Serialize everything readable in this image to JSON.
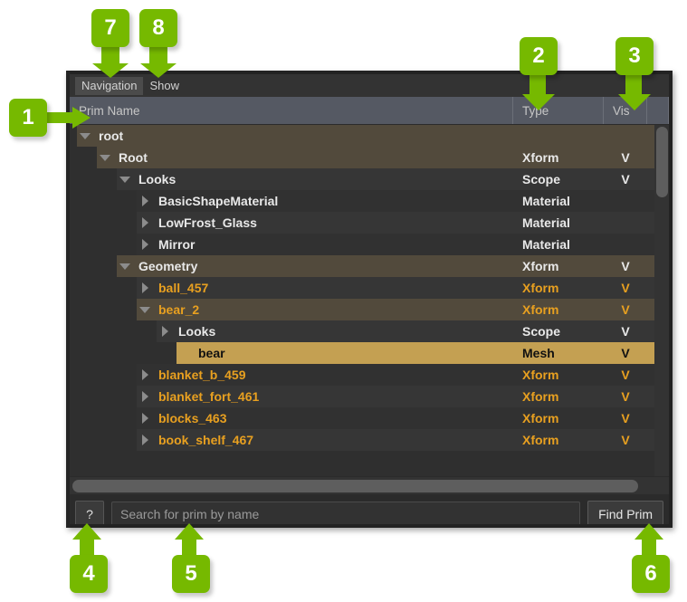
{
  "colors": {
    "badge_green": "#76b900",
    "selected_row": "#c4a052",
    "orange_text": "#e8a020",
    "panel_bg": "#2b2b2b"
  },
  "menubar": {
    "items": [
      {
        "label": "Navigation"
      },
      {
        "label": "Show"
      }
    ]
  },
  "columns": [
    {
      "label": "Prim Name"
    },
    {
      "label": "Type"
    },
    {
      "label": "Vis"
    }
  ],
  "tree": {
    "rows": [
      {
        "name": "root",
        "type": "",
        "vis": "",
        "depth": 0,
        "twisty": "down",
        "color": "white",
        "bg": "brown"
      },
      {
        "name": "Root",
        "type": "Xform",
        "vis": "V",
        "depth": 1,
        "twisty": "down",
        "color": "white",
        "bg": "brown"
      },
      {
        "name": "Looks",
        "type": "Scope",
        "vis": "V",
        "depth": 2,
        "twisty": "down",
        "color": "white",
        "bg": "dark"
      },
      {
        "name": "BasicShapeMaterial",
        "type": "Material",
        "vis": "",
        "depth": 3,
        "twisty": "right",
        "color": "white",
        "bg": "darker"
      },
      {
        "name": "LowFrost_Glass",
        "type": "Material",
        "vis": "",
        "depth": 3,
        "twisty": "right",
        "color": "white",
        "bg": "dark"
      },
      {
        "name": "Mirror",
        "type": "Material",
        "vis": "",
        "depth": 3,
        "twisty": "right",
        "color": "white",
        "bg": "darker"
      },
      {
        "name": "Geometry",
        "type": "Xform",
        "vis": "V",
        "depth": 2,
        "twisty": "down",
        "color": "white",
        "bg": "brown"
      },
      {
        "name": "ball_457",
        "type": "Xform",
        "vis": "V",
        "depth": 3,
        "twisty": "right",
        "color": "orange",
        "bg": "dark"
      },
      {
        "name": "bear_2",
        "type": "Xform",
        "vis": "V",
        "depth": 3,
        "twisty": "down",
        "color": "orange",
        "bg": "brown"
      },
      {
        "name": "Looks",
        "type": "Scope",
        "vis": "V",
        "depth": 4,
        "twisty": "right",
        "color": "white",
        "bg": "dark"
      },
      {
        "name": "bear",
        "type": "Mesh",
        "vis": "V",
        "depth": 5,
        "twisty": "none",
        "color": "black",
        "bg": "sel"
      },
      {
        "name": "blanket_b_459",
        "type": "Xform",
        "vis": "V",
        "depth": 3,
        "twisty": "right",
        "color": "orange",
        "bg": "darker"
      },
      {
        "name": "blanket_fort_461",
        "type": "Xform",
        "vis": "V",
        "depth": 3,
        "twisty": "right",
        "color": "orange",
        "bg": "dark"
      },
      {
        "name": "blocks_463",
        "type": "Xform",
        "vis": "V",
        "depth": 3,
        "twisty": "right",
        "color": "orange",
        "bg": "darker"
      },
      {
        "name": "book_shelf_467",
        "type": "Xform",
        "vis": "V",
        "depth": 3,
        "twisty": "right",
        "color": "orange",
        "bg": "dark"
      }
    ]
  },
  "bottombar": {
    "help_label": "?",
    "search_placeholder": "Search for prim by name",
    "search_value": "",
    "find_label": "Find Prim"
  },
  "callouts": [
    {
      "id": "1",
      "label": "1"
    },
    {
      "id": "2",
      "label": "2"
    },
    {
      "id": "3",
      "label": "3"
    },
    {
      "id": "4",
      "label": "4"
    },
    {
      "id": "5",
      "label": "5"
    },
    {
      "id": "6",
      "label": "6"
    },
    {
      "id": "7",
      "label": "7"
    },
    {
      "id": "8",
      "label": "8"
    }
  ]
}
